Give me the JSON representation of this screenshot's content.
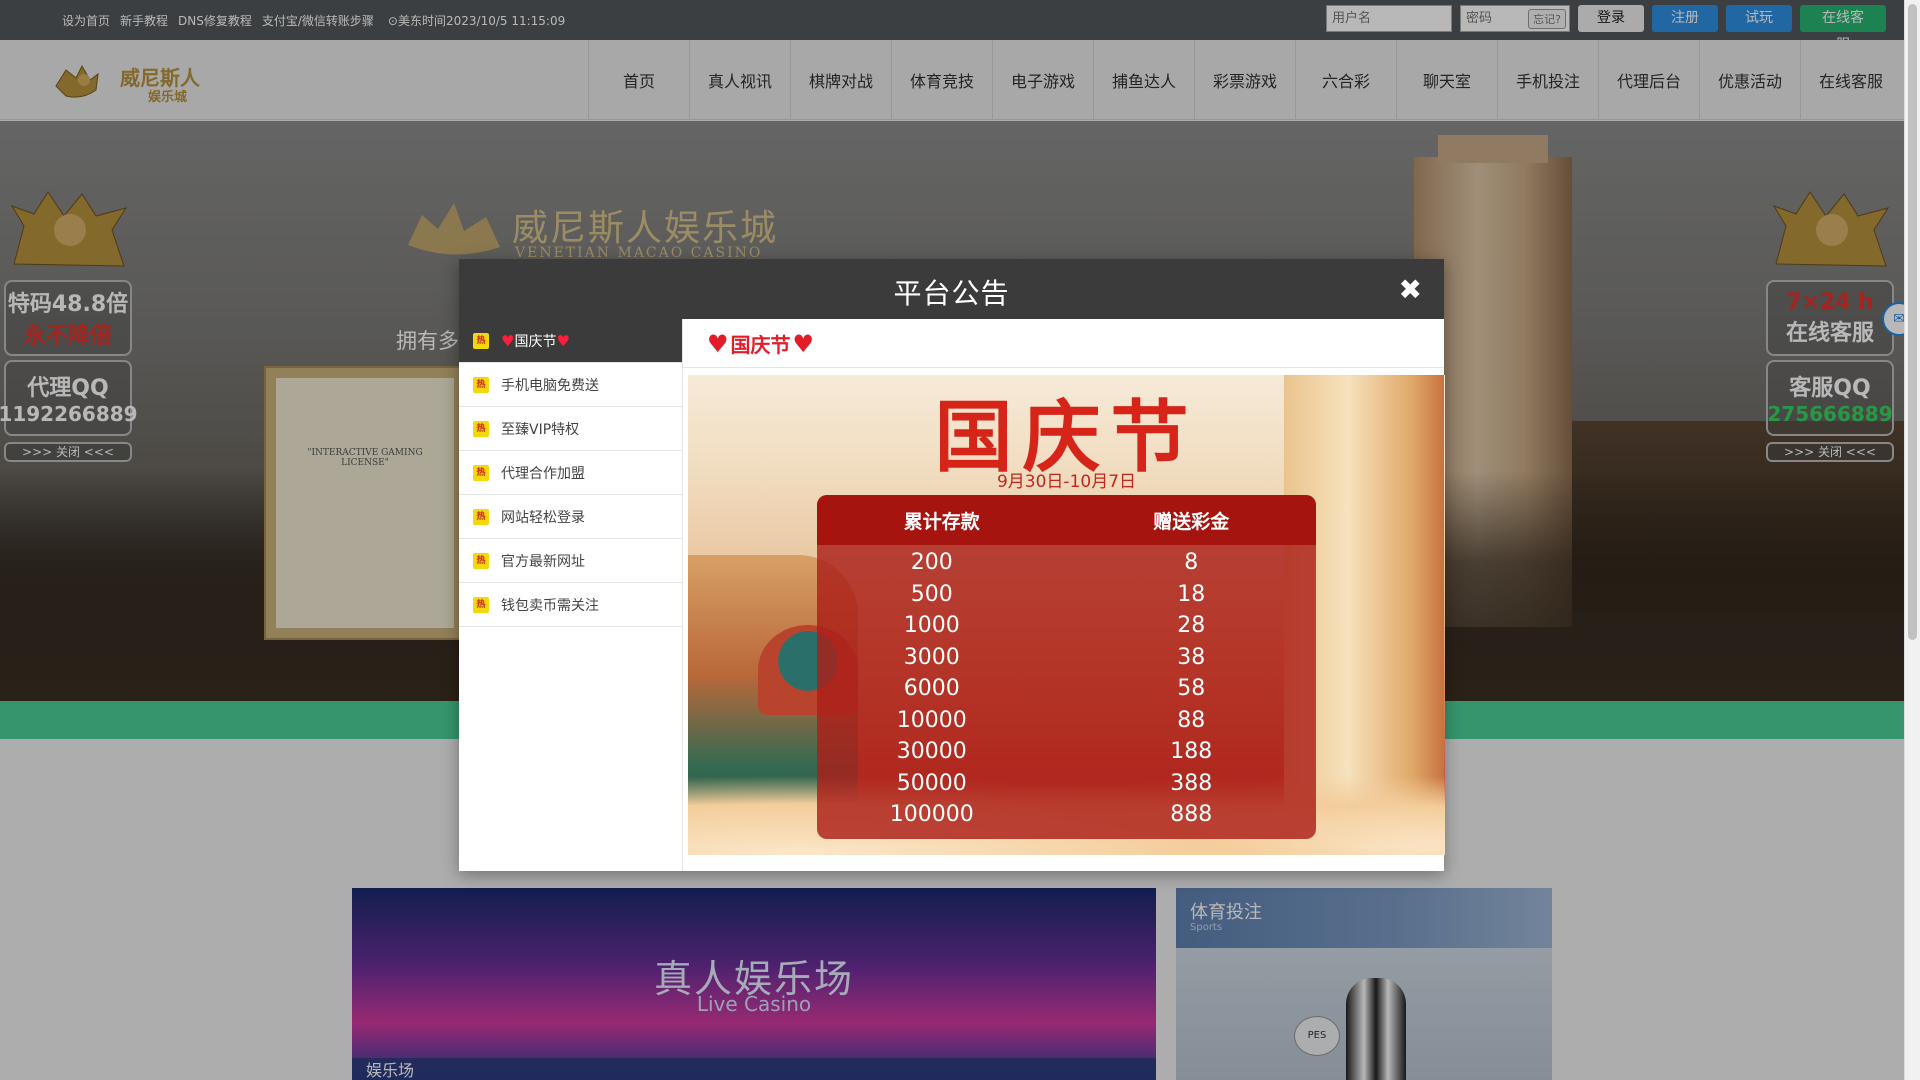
{
  "topbar": {
    "links": [
      "设为首页",
      "新手教程",
      "DNS修复教程",
      "支付宝/微信转账步骤"
    ],
    "clock": "美东时间2023/10/5 11:15:09",
    "username_placeholder": "用户名",
    "password_placeholder": "密码",
    "forgot_label": "忘记?",
    "login_label": "登录",
    "register_label": "注册",
    "trial_label": "试玩",
    "service_label": "在线客服"
  },
  "nav": {
    "logo_text": "威尼斯人",
    "logo_sub": "娱乐城",
    "items": [
      "首页",
      "真人视讯",
      "棋牌对战",
      "体育竞技",
      "电子游戏",
      "捕鱼达人",
      "彩票游戏",
      "六合彩",
      "聊天室",
      "手机投注",
      "代理后台",
      "优惠活动",
      "在线客服"
    ]
  },
  "banner": {
    "title": "威尼斯人娱乐城",
    "subtitle": "VENETIAN MACAO CASINO",
    "slogan": "拥有多",
    "license_text": "\"INTERACTIVE GAMING LICENSE\""
  },
  "float_left": {
    "box1_line1": "特码48.8倍",
    "box1_line2": "永不降倍",
    "box2_line1": "代理QQ",
    "box2_line2": "1192266889",
    "close": ">>> 关闭 <<<"
  },
  "float_right": {
    "box1_line1": "7×24 h",
    "box1_line2": "在线客服",
    "box2_line1": "客服QQ",
    "box2_line2": "275666889",
    "close": ">>> 关闭 <<<"
  },
  "modal": {
    "title": "平台公告",
    "close": "✖",
    "hot_badge": "热",
    "items": [
      "国庆节",
      "手机电脑免费送",
      "至臻VIP特权",
      "代理合作加盟",
      "网站轻松登录",
      "官方最新网址",
      "钱包卖币需关注"
    ],
    "active_title": "国庆节",
    "poster": {
      "title": "国庆节",
      "date": "9月30日-10月7日",
      "col1": "累计存款",
      "col2": "赠送彩金",
      "rows": [
        [
          "200",
          "8"
        ],
        [
          "500",
          "18"
        ],
        [
          "1000",
          "28"
        ],
        [
          "3000",
          "38"
        ],
        [
          "6000",
          "58"
        ],
        [
          "10000",
          "88"
        ],
        [
          "30000",
          "188"
        ],
        [
          "50000",
          "388"
        ],
        [
          "100000",
          "888"
        ]
      ]
    }
  },
  "bottom": {
    "casino_title": "真人娱乐场",
    "casino_sub": "Live Casino",
    "casino_foot": "娱乐场",
    "sports_title": "体育投注",
    "sports_sub": "Sports",
    "ball_label": "PES"
  },
  "colors": {
    "topbar": "#54585b",
    "accent_blue": "#2f8fe3",
    "accent_green": "#27b572",
    "strip_green": "#4ccf95",
    "modal_head": "#3b3b3b",
    "festival_red": "#d62518"
  }
}
